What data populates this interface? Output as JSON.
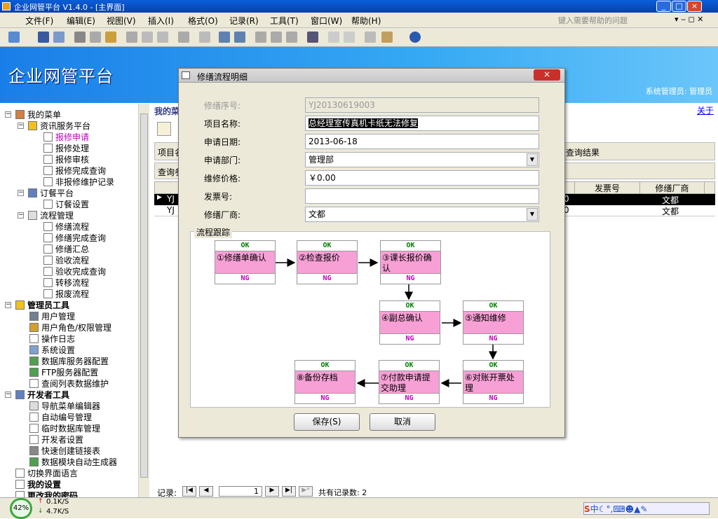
{
  "app": {
    "title": "企业网管平台  V1.4.0 - [主界面]",
    "banner_title": "企业网管平台",
    "user_text": "系统管理员: 管理员"
  },
  "menu": [
    "文件(F)",
    "编辑(E)",
    "视图(V)",
    "插入(I)",
    "格式(O)",
    "记录(R)",
    "工具(T)",
    "窗口(W)",
    "帮助(H)"
  ],
  "help_placeholder": "键入需要帮助的问题",
  "tree": {
    "items": [
      {
        "label": "我的菜单",
        "bold": false
      },
      {
        "label": "资讯服务平台"
      },
      {
        "label": "报修申请"
      },
      {
        "label": "报修处理"
      },
      {
        "label": "报修审核"
      },
      {
        "label": "报修完成查询"
      },
      {
        "label": "非报修维护记录"
      },
      {
        "label": "订餐平台"
      },
      {
        "label": "订餐设置"
      },
      {
        "label": "流程管理"
      },
      {
        "label": "修缮流程"
      },
      {
        "label": "修缮完成查询"
      },
      {
        "label": "修缮汇总"
      },
      {
        "label": "验收流程"
      },
      {
        "label": "验收完成查询"
      },
      {
        "label": "转移流程"
      },
      {
        "label": "报废流程"
      },
      {
        "label": "管理员工具"
      },
      {
        "label": "用户管理"
      },
      {
        "label": "用户角色/权限管理"
      },
      {
        "label": "操作日志"
      },
      {
        "label": "系统设置"
      },
      {
        "label": "数据库服务器配置"
      },
      {
        "label": "FTP服务器配置"
      },
      {
        "label": "查阅列表数据维护"
      },
      {
        "label": "开发者工具"
      },
      {
        "label": "导航菜单编辑器"
      },
      {
        "label": "自动编号管理"
      },
      {
        "label": "临时数据库管理"
      },
      {
        "label": "开发者设置"
      },
      {
        "label": "快速创建链接表"
      },
      {
        "label": "数据模块自动生成器"
      },
      {
        "label": "切换界面语言"
      },
      {
        "label": "我的设置"
      },
      {
        "label": "更改我的密码"
      }
    ]
  },
  "main": {
    "header": "我的菜",
    "about": "关于",
    "query_text": "于查询结果",
    "proj_label": "项目名",
    "query_label": "查询参",
    "table": {
      "headers": [
        "发票号",
        "修缮厂商"
      ],
      "rows": [
        [
          "YJ",
          "0",
          "",
          "文都"
        ],
        [
          "YJ",
          "0",
          "",
          "文都"
        ]
      ]
    },
    "nav": {
      "label": "记录:",
      "current": "1",
      "total_text": "共有记录数: 2"
    }
  },
  "dialog": {
    "title": "修缮流程明细",
    "fields": [
      {
        "label": "修缮序号:",
        "value": "YJ20130619003",
        "disabled": true
      },
      {
        "label": "项目名称:",
        "value": "总经理室传真机卡纸无法修复",
        "highlight": true
      },
      {
        "label": "申请日期:",
        "value": "2013-06-18"
      },
      {
        "label": "申请部门:",
        "value": "管理部",
        "dropdown": true
      },
      {
        "label": "维修价格:",
        "value": "￥0.00"
      },
      {
        "label": "发票号:",
        "value": ""
      },
      {
        "label": "修缮厂商:",
        "value": "文都",
        "dropdown": true
      }
    ],
    "flow_title": "流程跟踪",
    "steps": [
      {
        "ok": "OK",
        "text": "①修缮单确认",
        "ng": "NG"
      },
      {
        "ok": "OK",
        "text": "②检查报价",
        "ng": "NG"
      },
      {
        "ok": "OK",
        "text": "③课长报价确认",
        "ng": "NG"
      },
      {
        "ok": "OK",
        "text": "④副总确认",
        "ng": "NG"
      },
      {
        "ok": "OK",
        "text": "⑤通知维修",
        "ng": "NG"
      },
      {
        "ok": "OK",
        "text": "⑥对账开票处理",
        "ng": "NG"
      },
      {
        "ok": "OK",
        "text": "⑦付款申请提交助理",
        "ng": "NG"
      },
      {
        "ok": "OK",
        "text": "⑧备份存档",
        "ng": "NG"
      }
    ],
    "save": "保存(S)",
    "cancel": "取消"
  },
  "status": {
    "cpu": "42%",
    "up": "0.1K/S",
    "down": "4.7K/S"
  },
  "colors": {
    "accent": "#1a7ee8",
    "pink": "#f7a0d6",
    "ok": "#008000",
    "ng": "#c000c0"
  }
}
